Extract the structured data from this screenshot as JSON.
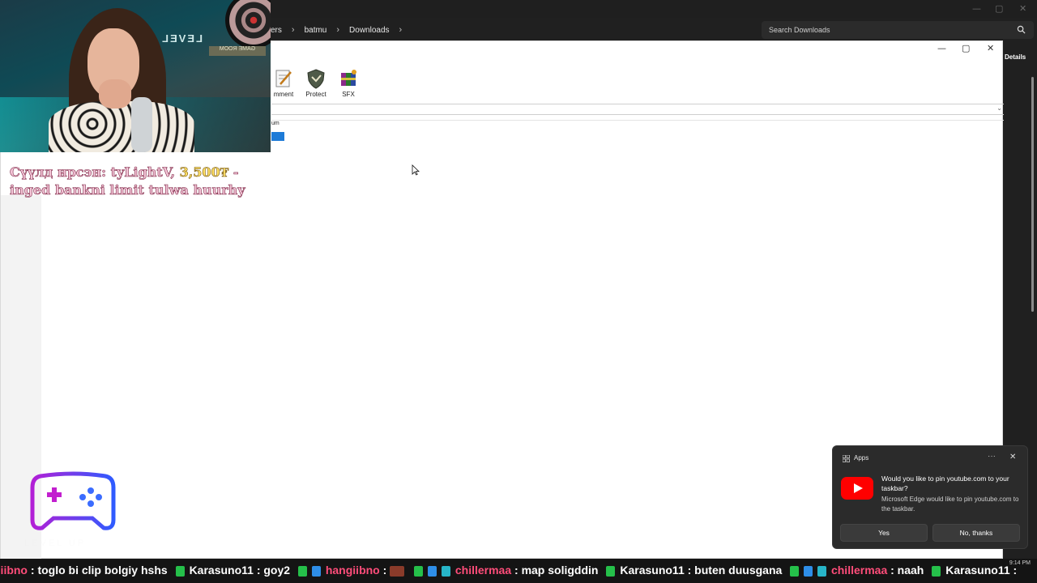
{
  "explorer": {
    "breadcrumb": [
      "ers",
      "batmu",
      "Downloads"
    ],
    "search_placeholder": "Search Downloads",
    "details_label": "Details"
  },
  "winrar": {
    "tools": [
      {
        "label": "mment",
        "icon": "comment-icon"
      },
      {
        "label": "Protect",
        "icon": "shield-icon"
      },
      {
        "label": "SFX",
        "icon": "sfx-archive-icon"
      }
    ],
    "file_header": "um"
  },
  "alert": {
    "prefix": "Сүүлд ирсэн: tyLightV,",
    "amount": "3,500₮",
    "suffix": "- inged bankni limit tulwa huurhy"
  },
  "logo_caption": "LEVEL UP",
  "toast": {
    "app": "Apps",
    "message": "Would you like to pin youtube.com to your taskbar?",
    "sub": "Microsoft Edge would like to pin youtube.com to the taskbar.",
    "yes": "Yes",
    "no": "No, thanks",
    "colors": {
      "youtube": "#ff0000"
    }
  },
  "ticker": {
    "items": [
      {
        "user": "giibno",
        "text": ": toglo bi clip bolgiy hshs"
      },
      {
        "user": "Karasuno11",
        "text": ": goy2"
      },
      {
        "user": "hangiibno",
        "text": ":"
      },
      {
        "user": "chillermaa",
        "text": ": map soligddin"
      },
      {
        "user": "Karasuno11",
        "text": ": buten duusgana"
      },
      {
        "user": "chillermaa",
        "text": ": naah"
      },
      {
        "user": "Karasuno11",
        "text": ":"
      }
    ]
  },
  "tray": {
    "time": "9:14 PM"
  }
}
